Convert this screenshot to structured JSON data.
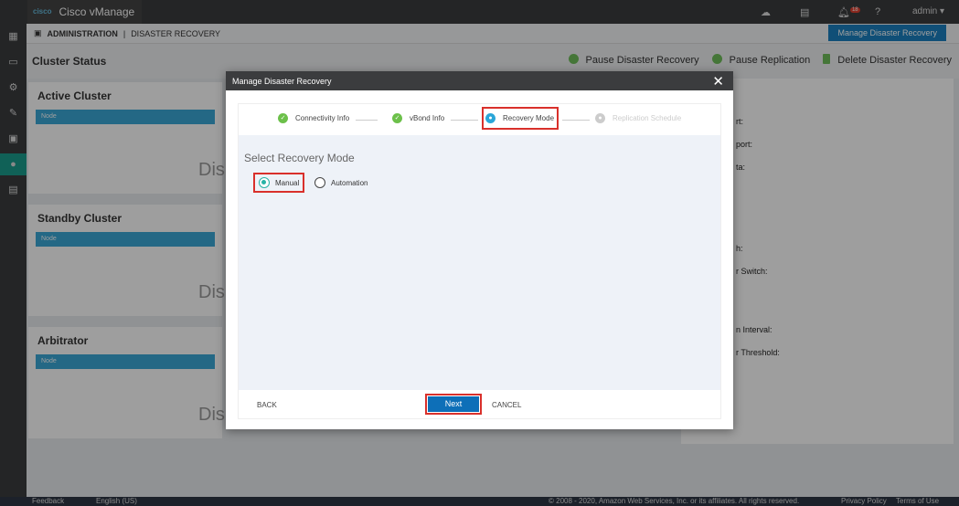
{
  "app": {
    "title": "Cisco vManage",
    "logo_text": "cisco",
    "user": "admin",
    "notification_count": "18"
  },
  "header": {
    "section": "ADMINISTRATION",
    "page": "DISASTER RECOVERY",
    "manage_button": "Manage Disaster Recovery"
  },
  "cluster": {
    "title": "Cluster Status",
    "actions": [
      "Pause Disaster Recovery",
      "Pause Replication",
      "Delete Disaster Recovery"
    ],
    "panels": [
      {
        "title": "Active Cluster",
        "column": "Node",
        "empty": "Dis"
      },
      {
        "title": "Standby Cluster",
        "column": "Node",
        "empty": "Dis"
      },
      {
        "title": "Arbitrator",
        "column": "Node",
        "empty": "Dis"
      }
    ],
    "right_labels": [
      "rt:",
      "port:",
      "ta:",
      "h:",
      "r Switch:",
      "n Interval:",
      "r Threshold:"
    ]
  },
  "modal": {
    "title": "Manage Disaster Recovery",
    "steps": [
      {
        "label": "Connectivity Info",
        "state": "done"
      },
      {
        "label": "vBond Info",
        "state": "done"
      },
      {
        "label": "Recovery Mode",
        "state": "active"
      },
      {
        "label": "Replication Schedule",
        "state": "pending"
      }
    ],
    "section_title": "Select Recovery Mode",
    "options": [
      {
        "label": "Manual",
        "selected": true
      },
      {
        "label": "Automation",
        "selected": false
      }
    ],
    "back": "BACK",
    "next": "Next",
    "cancel": "CANCEL"
  },
  "footer": {
    "feedback": "Feedback",
    "language": "English (US)",
    "copyright": "© 2008 - 2020, Amazon Web Services, Inc. or its affiliates. All rights reserved.",
    "privacy": "Privacy Policy",
    "terms": "Terms of Use"
  },
  "colors": {
    "accent": "#0d6fb8",
    "highlight": "#d9302b",
    "success": "#6cc04a",
    "radio": "#27b3a6"
  }
}
